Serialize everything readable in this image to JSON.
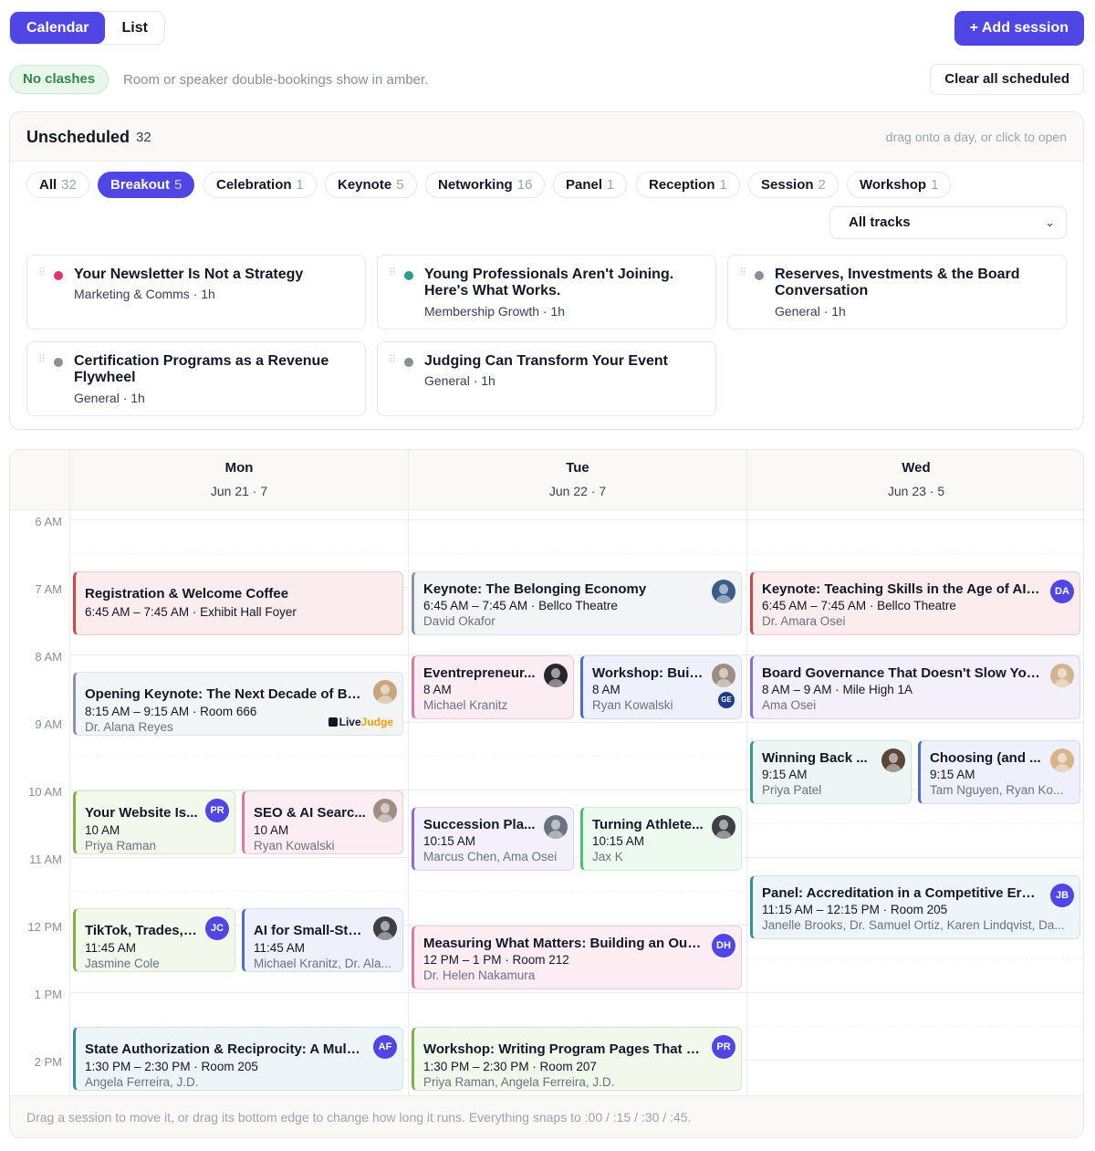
{
  "view_toggle": {
    "calendar": "Calendar",
    "list": "List"
  },
  "add_session": "+ Add session",
  "clash": {
    "badge": "No clashes",
    "note": "Room or speaker double-bookings show in amber."
  },
  "clear_all": "Clear all scheduled",
  "unscheduled": {
    "title": "Unscheduled",
    "count": "32",
    "hint": "drag onto a day, or click to open",
    "filters": [
      {
        "label": "All",
        "count": "32"
      },
      {
        "label": "Breakout",
        "count": "5"
      },
      {
        "label": "Celebration",
        "count": "1"
      },
      {
        "label": "Keynote",
        "count": "5"
      },
      {
        "label": "Networking",
        "count": "16"
      },
      {
        "label": "Panel",
        "count": "1"
      },
      {
        "label": "Reception",
        "count": "1"
      },
      {
        "label": "Session",
        "count": "2"
      },
      {
        "label": "Workshop",
        "count": "1"
      }
    ],
    "track_select": "All tracks",
    "cards": [
      {
        "title": "Your Newsletter Is Not a Strategy",
        "meta": "Marketing & Comms · 1h",
        "color": "#e0356b"
      },
      {
        "title": "Young Professionals Aren't Joining. Here's What Works.",
        "meta": "Membership Growth · 1h",
        "color": "#2a9d8f"
      },
      {
        "title": "Reserves, Investments & the Board Conversation",
        "meta": "General · 1h",
        "color": "#8a8f98"
      },
      {
        "title": "Certification Programs as a Revenue Flywheel",
        "meta": "General · 1h",
        "color": "#8a8f98"
      },
      {
        "title": "Judging Can Transform Your Event",
        "meta": "General · 1h",
        "color": "#8a8f98"
      }
    ]
  },
  "calendar": {
    "days": [
      {
        "name": "Mon",
        "date": "Jun 21 · 7"
      },
      {
        "name": "Tue",
        "date": "Jun 22 · 7"
      },
      {
        "name": "Wed",
        "date": "Jun 23 · 5"
      }
    ],
    "hours": [
      "6 AM",
      "7 AM",
      "8 AM",
      "9 AM",
      "10 AM",
      "11 AM",
      "12 PM",
      "1 PM",
      "2 PM"
    ],
    "events": [
      {
        "title": "Registration & Welcome Coffee",
        "time": "6:45 AM – 7:45 AM · Exhibit Hall Foyer",
        "who": ""
      },
      {
        "title": "Opening Keynote: The Next Decade of Be...",
        "time": "8:15 AM – 9:15 AM · Room 666",
        "who": "Dr. Alana Reyes",
        "sponsor_a": "Live",
        "sponsor_b": "Judge"
      },
      {
        "title": "Your Website Is...",
        "time": "10 AM",
        "who": "Priya Raman",
        "avatar": "PR"
      },
      {
        "title": "SEO & AI Searc...",
        "time": "10 AM",
        "who": "Ryan Kowalski"
      },
      {
        "title": "TikTok, Trades, ...",
        "time": "11:45 AM",
        "who": "Jasmine Cole",
        "avatar": "JC"
      },
      {
        "title": "AI for Small-Sta...",
        "time": "11:45 AM",
        "who": "Michael Kranitz, Dr. Ala..."
      },
      {
        "title": "State Authorization & Reciprocity: A Multi...",
        "time": "1:30 PM – 2:30 PM · Room 205",
        "who": "Angela Ferreira, J.D.",
        "avatar": "AF"
      },
      {
        "title": "Keynote: The Belonging Economy",
        "time": "6:45 AM – 7:45 AM · Bellco Theatre",
        "who": "David Okafor"
      },
      {
        "title": "Eventrepreneur...",
        "time": "8 AM",
        "who": "Michael Kranitz"
      },
      {
        "title": "Workshop: Buil...",
        "time": "8 AM",
        "who": "Ryan Kowalski",
        "avatar2": "GE"
      },
      {
        "title": "Succession Pla...",
        "time": "10:15 AM",
        "who": "Marcus Chen, Ama Osei"
      },
      {
        "title": "Turning Athlete...",
        "time": "10:15 AM",
        "who": "Jax K"
      },
      {
        "title": "Measuring What Matters: Building an Out...",
        "time": "12 PM – 1 PM · Room 212",
        "who": "Dr. Helen Nakamura",
        "avatar": "DH"
      },
      {
        "title": "Workshop: Writing Program Pages That P...",
        "time": "1:30 PM – 2:30 PM · Room 207",
        "who": "Priya Raman, Angela Ferreira, J.D.",
        "avatar": "PR"
      },
      {
        "title": "Keynote: Teaching Skills in the Age of AI ...",
        "time": "6:45 AM – 7:45 AM · Bellco Theatre",
        "who": "Dr. Amara Osei",
        "avatar": "DA"
      },
      {
        "title": "Board Governance That Doesn't Slow You...",
        "time": "8 AM – 9 AM · Mile High 1A",
        "who": "Ama Osei"
      },
      {
        "title": "Winning Back ...",
        "time": "9:15 AM",
        "who": "Priya Patel"
      },
      {
        "title": "Choosing (and ...",
        "time": "9:15 AM",
        "who": "Tam Nguyen, Ryan Ko..."
      },
      {
        "title": "Panel: Accreditation in a Competitive Era ...",
        "time": "11:15 AM – 12:15 PM · Room 205",
        "who": "Janelle Brooks, Dr. Samuel Ortiz, Karen Lindqvist, Da...",
        "avatar": "JB"
      }
    ],
    "footer": "Drag a session to move it, or drag its bottom edge to change how long it runs. Everything snaps to :00 / :15 / :30 / :45."
  },
  "colors": {
    "accent": "#4f46e5",
    "red": "#e05a5a",
    "slate": "#8a94a6",
    "green": "#7cb342",
    "pink": "#e07a9a",
    "purple": "#8b6cd8",
    "blue": "#4f6ad8",
    "teal": "#3a9a8a"
  }
}
